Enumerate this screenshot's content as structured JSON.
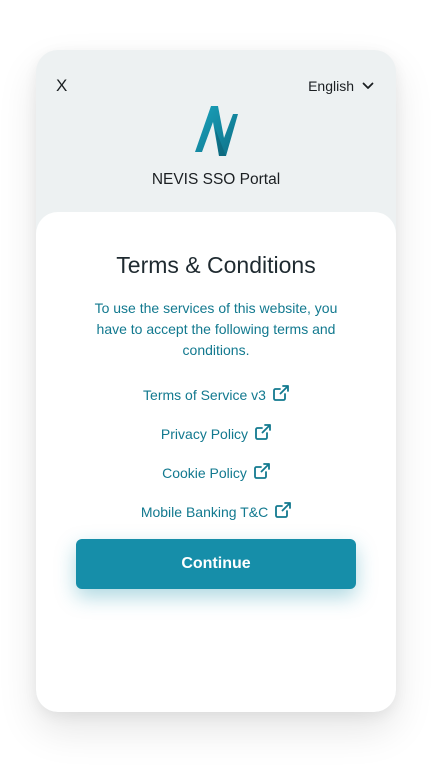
{
  "header": {
    "close_label": "X",
    "language": "English",
    "language_icon": "chevron-down-icon",
    "logo_icon": "nevis-logo-icon",
    "portal_title": "NEVIS SSO Portal"
  },
  "card": {
    "title": "Terms & Conditions",
    "description": "To use the services of this website, you have to accept the following terms and conditions.",
    "links": [
      {
        "label": "Terms of Service v3",
        "icon": "external-link-icon"
      },
      {
        "label": "Privacy Policy",
        "icon": "external-link-icon"
      },
      {
        "label": "Cookie Policy",
        "icon": "external-link-icon"
      },
      {
        "label": "Mobile Banking T&C",
        "icon": "external-link-icon"
      }
    ],
    "continue_label": "Continue"
  },
  "colors": {
    "accent": "#168ea9",
    "link": "#12798f",
    "background": "#edf1f2"
  }
}
